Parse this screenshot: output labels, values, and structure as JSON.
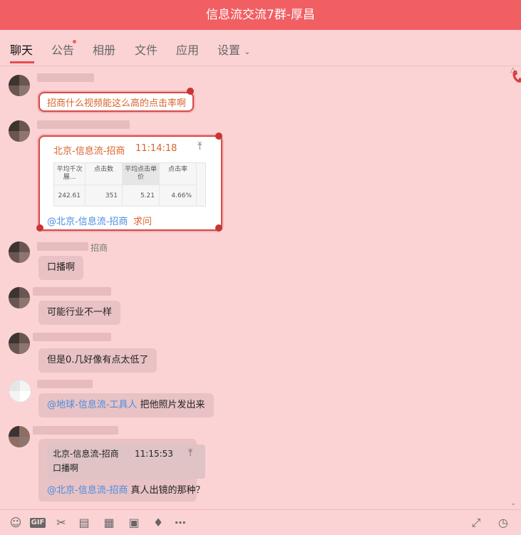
{
  "window": {
    "title": "信息流交流7群-厚昌"
  },
  "tabs": [
    {
      "label": "聊天"
    },
    {
      "label": "公告"
    },
    {
      "label": "相册"
    },
    {
      "label": "文件"
    },
    {
      "label": "应用"
    },
    {
      "label": "设置"
    }
  ],
  "messages": {
    "m1": {
      "text": "招商什么视频能这么高的点击率啊"
    },
    "m2": {
      "header_name": "北京-信息流-招商",
      "header_time": "11:14:18",
      "table": {
        "headers": [
          "平均千次展...",
          "点击数",
          "平均点击单价",
          "点击率"
        ],
        "values": [
          "242.61",
          "351",
          "5.21",
          "4.66%"
        ]
      },
      "mention": "@北京-信息流-招商",
      "text": "求问"
    },
    "m3": {
      "nick_suffix": "招商",
      "text": "口播啊"
    },
    "m4": {
      "text": "可能行业不一样"
    },
    "m5": {
      "text": "但是0.几好像有点太低了"
    },
    "m6": {
      "mention": "@地球-信息流-工具人",
      "text": "把他照片发出来"
    },
    "m7": {
      "quote_name": "北京-信息流-招商",
      "quote_time": "11:15:53",
      "quote_text": "口播啊",
      "mention": "@北京-信息流-招商",
      "text": "真人出镜的那种？"
    }
  },
  "icons": {
    "phone": "phone-icon",
    "toolbar": [
      "emoji-icon",
      "gif-icon",
      "scissors-icon",
      "folder-icon",
      "code-icon",
      "image-icon",
      "bell-icon",
      "more-icon",
      "expand-icon",
      "history-icon"
    ]
  },
  "colors": {
    "titlebar": "#f15f63",
    "background": "#fbd3d5",
    "accent": "#e84b51",
    "mention": "#4a8de0"
  }
}
